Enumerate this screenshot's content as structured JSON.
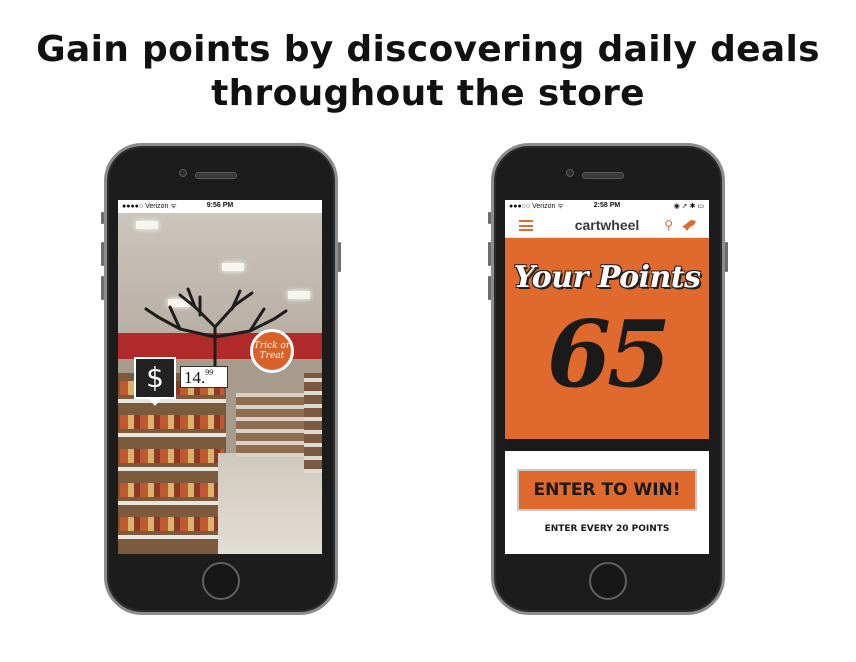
{
  "headline": {
    "line1": "Gain points by discovering daily deals",
    "line2": "throughout the store"
  },
  "left_phone": {
    "status": {
      "carrier": "●●●●○ Verizon ᯤ",
      "time": "9:56 PM"
    },
    "price_tag": {
      "dollars": "14.",
      "cents": "99"
    },
    "deal_marker": "$",
    "badge": {
      "line1": "Trick or",
      "line2": "Treat"
    }
  },
  "right_phone": {
    "status": {
      "carrier": "●●●○○ Verizon ᯤ",
      "time": "2:58 PM",
      "icons": "◉ ➚ ✱ ▭"
    },
    "app": {
      "brand": "cartwheel"
    },
    "points": {
      "title": "Your Points",
      "value": "65"
    },
    "enter_button": "ENTER TO WIN!",
    "enter_note": "ENTER EVERY 20 POINTS"
  },
  "colors": {
    "accent": "#e0692d",
    "dark": "#1a1a1a"
  },
  "icons": [
    "menu-icon",
    "search-icon",
    "bullseye-icon",
    "dollar-icon",
    "home-button"
  ]
}
